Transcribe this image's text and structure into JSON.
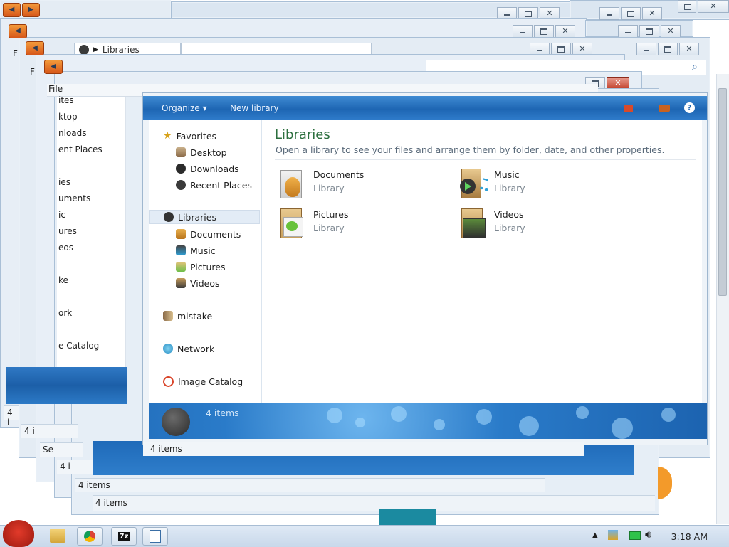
{
  "background_window": {
    "file_menu": "File",
    "breadcrumb": "Libraries",
    "left_partial_items": [
      "ites",
      "ktop",
      "nloads",
      "ent Places",
      "ies",
      "uments",
      "ic",
      "ures",
      "eos",
      "ke",
      "ork",
      "e Catalog"
    ],
    "status_text": "4 items",
    "status_short": "4 i",
    "status_se": "Se"
  },
  "toolbar": {
    "organize_label": "Organize ▾",
    "new_library_label": "New library",
    "help_label": "?"
  },
  "nav": {
    "favorites": "Favorites",
    "desktop": "Desktop",
    "downloads": "Downloads",
    "recent": "Recent Places",
    "libraries": "Libraries",
    "documents": "Documents",
    "music": "Music",
    "pictures": "Pictures",
    "videos": "Videos",
    "homegroup": "mistake",
    "network": "Network",
    "image_catalog": "Image Catalog"
  },
  "content": {
    "title": "Libraries",
    "subtitle": "Open a library to see your files and arrange them by folder, date, and other properties.",
    "libraries": [
      {
        "name": "Documents",
        "kind": "Library",
        "icon": "documents-library-icon"
      },
      {
        "name": "Music",
        "kind": "Library",
        "icon": "music-library-icon"
      },
      {
        "name": "Pictures",
        "kind": "Library",
        "icon": "pictures-library-icon"
      },
      {
        "name": "Videos",
        "kind": "Library",
        "icon": "videos-library-icon"
      }
    ]
  },
  "status": {
    "items": "4 items"
  },
  "taskbar": {
    "clock": "3:18 AM",
    "apps": [
      "angry-birds-start-icon",
      "explorer-icon",
      "chrome-icon",
      "7zip-icon",
      "notepad-icon"
    ],
    "sevenzip_label": "7z"
  },
  "colors": {
    "accent_blue": "#1e66b3",
    "title_green": "#2c6f3e",
    "orange_nav": "#e0701f"
  }
}
